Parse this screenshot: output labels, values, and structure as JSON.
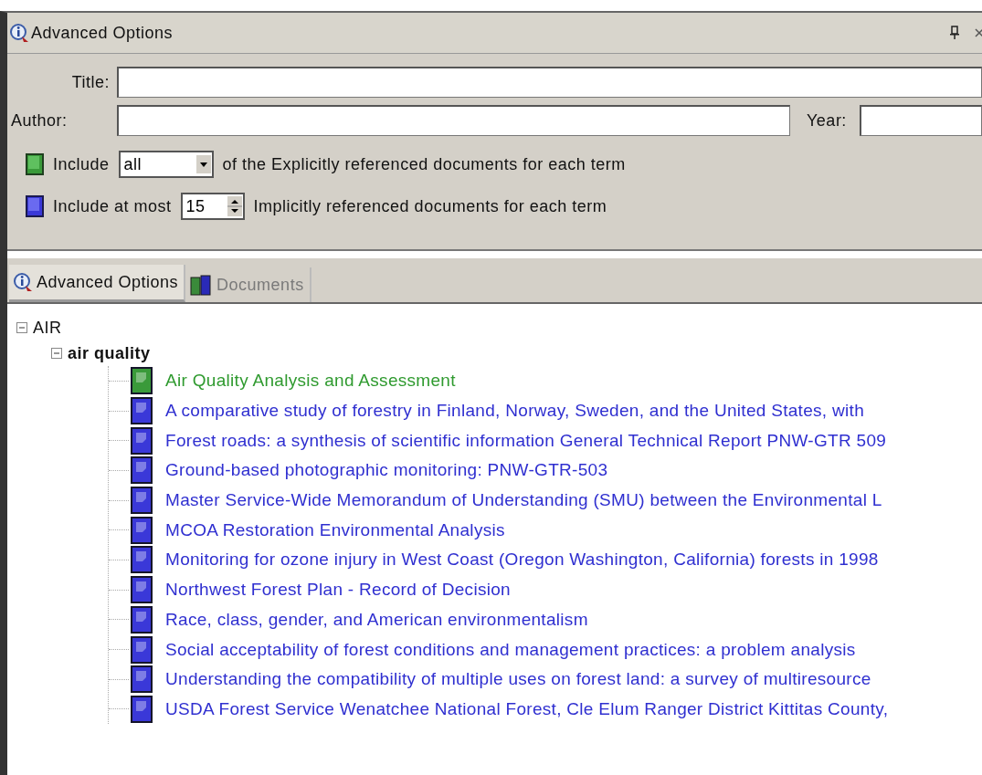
{
  "panel": {
    "title": "Advanced Options"
  },
  "form": {
    "title_label": "Title:",
    "author_label": "Author:",
    "year_label": "Year:",
    "explicit": {
      "before": "Include",
      "select_value": "all",
      "after": "of the Explicitly referenced documents for each term"
    },
    "implicit": {
      "before": "Include at most",
      "spin_value": "15",
      "after": "Implicitly referenced documents for each term"
    }
  },
  "tabs": [
    {
      "label": "Advanced Options",
      "selected": true
    },
    {
      "label": "Documents",
      "selected": false
    }
  ],
  "tree": [
    {
      "label": "AIR",
      "expanded": true,
      "children": [
        {
          "label": "air quality",
          "expanded": true,
          "children": [
            {
              "label": "Air Quality Analysis and Assessment",
              "kind": "explicit"
            },
            {
              "label": "A comparative study of forestry in Finland, Norway, Sweden, and the United States, with",
              "kind": "implicit"
            },
            {
              "label": "Forest roads: a synthesis of scientific information General Technical Report PNW-GTR 509",
              "kind": "implicit"
            },
            {
              "label": "Ground-based photographic monitoring: PNW-GTR-503",
              "kind": "implicit"
            },
            {
              "label": "Master  Service-Wide Memorandum of Understanding (SMU) between the Environmental L",
              "kind": "implicit"
            },
            {
              "label": "MCOA Restoration Environmental Analysis",
              "kind": "implicit"
            },
            {
              "label": "Monitoring for ozone injury in West Coast (Oregon Washington, California) forests in 1998",
              "kind": "implicit"
            },
            {
              "label": "Northwest Forest Plan - Record of Decision",
              "kind": "implicit"
            },
            {
              "label": "Race, class, gender, and American environmentalism",
              "kind": "implicit"
            },
            {
              "label": "Social acceptability of forest conditions and management practices: a problem analysis",
              "kind": "implicit"
            },
            {
              "label": "Understanding the compatibility of multiple uses on forest land: a survey of multiresource",
              "kind": "implicit"
            },
            {
              "label": "USDA Forest Service Wenatchee National Forest, Cle Elum Ranger District Kittitas County,",
              "kind": "implicit"
            }
          ]
        }
      ]
    }
  ]
}
